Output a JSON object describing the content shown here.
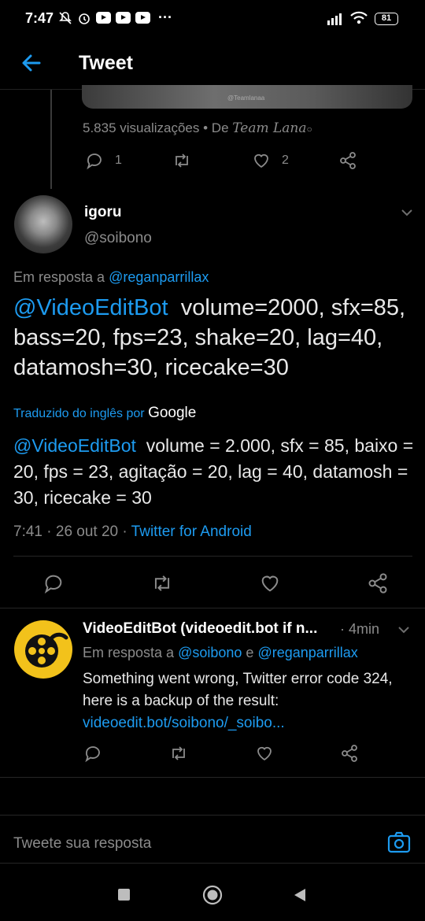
{
  "status_bar": {
    "time": "7:47",
    "dots": "···",
    "battery": "81"
  },
  "header": {
    "title": "Tweet"
  },
  "media": {
    "watermark": "@Teamlanaa"
  },
  "prev_tweet": {
    "views_prefix": "5.835 visualizações",
    "views_sep": "•",
    "views_by": "De",
    "views_source": "Team Lana",
    "reply_count": "1",
    "retweet_count": "",
    "like_count": "2"
  },
  "main_tweet": {
    "name": "igoru",
    "handle": "@soibono",
    "reply_prefix": "Em resposta a",
    "reply_to": "@reganparrillax",
    "mention": "@VideoEditBot",
    "text": "volume=2000, sfx=85, bass=20, fps=23, shake=20, lag=40, datamosh=30, ricecake=30",
    "translated_label": "Traduzido do inglês por",
    "translated_by": "Google",
    "translation_mention": "@VideoEditBot",
    "translation_text": "volume = 2.000, sfx = 85, baixo = 20, fps = 23, agitação = 20, lag = 40, datamosh = 30, ricecake = 30",
    "time": "7:41",
    "date": "26 out 20",
    "client": "Twitter for Android"
  },
  "reply_tweet": {
    "name": "VideoEditBot (videoedit.bot if n...",
    "time": "· 4min",
    "reply_prefix": "Em resposta a",
    "reply_to_1": "@soibono",
    "reply_and": "e",
    "reply_to_2": "@reganparrillax",
    "text": "Something went wrong, Twitter error code 324, here is a backup of the result:",
    "link": "videoedit.bot/soibono/_soibo..."
  },
  "compose": {
    "placeholder": "Tweete sua resposta"
  },
  "colors": {
    "accent": "#1d9bf0",
    "background": "#000000",
    "muted": "#8b8b8b"
  },
  "icons": [
    "back-arrow-icon",
    "reply-icon",
    "retweet-icon",
    "like-icon",
    "share-icon",
    "camera-icon",
    "chevron-down-icon"
  ]
}
